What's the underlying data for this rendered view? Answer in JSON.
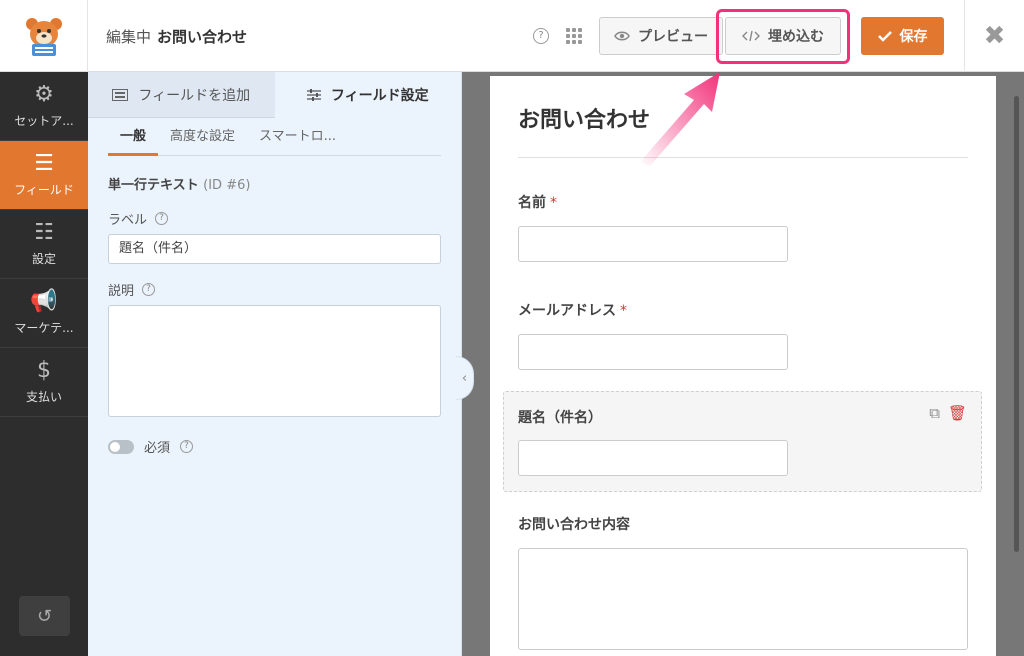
{
  "header": {
    "editing_prefix": "編集中",
    "form_name": "お問い合わせ",
    "preview_label": "プレビュー",
    "embed_label": "埋め込む",
    "save_label": "保存",
    "help_glyph": "?",
    "close_glyph": "✖"
  },
  "icons": {
    "logo": "wpforms-bear-logo",
    "help": "question-circle-icon",
    "apps": "grid-icon",
    "preview": "eye-icon",
    "embed": "code-icon",
    "save": "checkmark-icon",
    "close": "close-icon"
  },
  "colors": {
    "accent": "#e27730",
    "highlight": "#f2317a",
    "sidebar_bg": "#2d2d2d",
    "panel_bg": "#ebf3fc",
    "required": "#d63638"
  },
  "sidebar": {
    "items": [
      {
        "label": "セットア...",
        "icon": "gear-icon",
        "glyph": "⚙"
      },
      {
        "label": "フィールド",
        "icon": "fields-list-icon",
        "glyph": "☰"
      },
      {
        "label": "設定",
        "icon": "sliders-icon",
        "glyph": "☷"
      },
      {
        "label": "マーケテ...",
        "icon": "megaphone-icon",
        "glyph": "📢"
      },
      {
        "label": "支払い",
        "icon": "dollar-icon",
        "glyph": "$"
      }
    ],
    "undo_glyph": "↺"
  },
  "panel": {
    "tabs": [
      "フィールドを追加",
      "フィールド設定"
    ],
    "subtabs": [
      "一般",
      "高度な設定",
      "スマートロ..."
    ],
    "field_type": "単一行テキスト",
    "field_id": "(ID #6)",
    "label_caption": "ラベル",
    "label_value": "題名（件名）",
    "description_caption": "説明",
    "required_caption": "必須",
    "collapse_glyph": "‹"
  },
  "form": {
    "title": "お問い合わせ",
    "fields": [
      {
        "label": "名前",
        "required": true
      },
      {
        "label": "メールアドレス",
        "required": true
      },
      {
        "label": "題名（件名）",
        "required": false
      },
      {
        "label": "お問い合わせ内容",
        "required": false
      }
    ],
    "required_mark": "*",
    "duplicate_glyph": "⧉",
    "delete_glyph": "🗑"
  }
}
